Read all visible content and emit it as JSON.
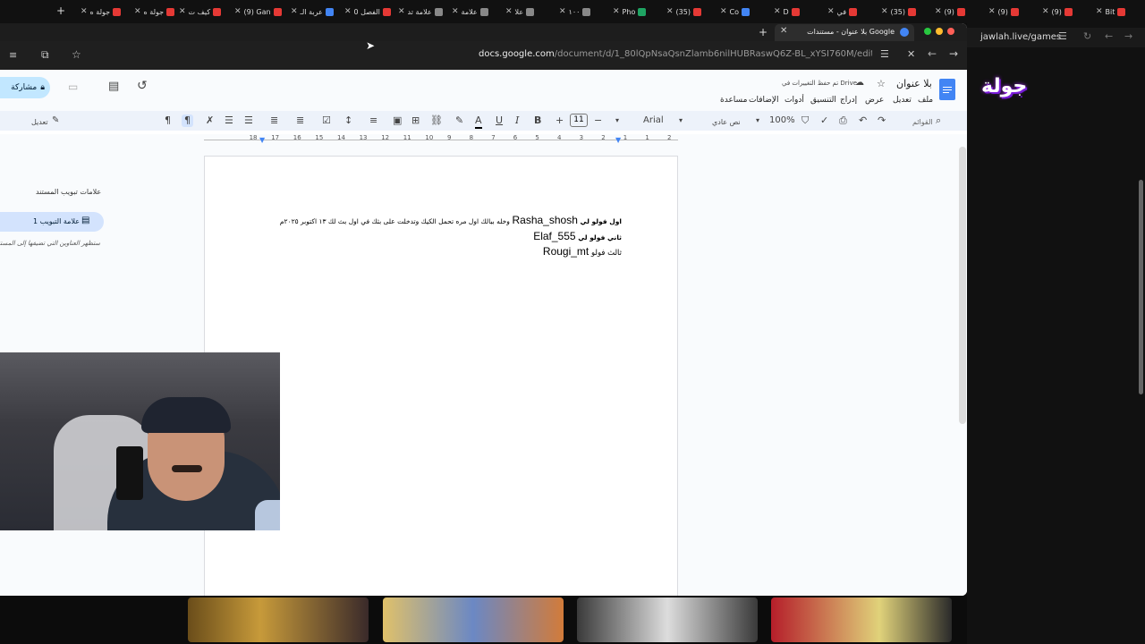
{
  "tabs": [
    {
      "label": "جولة ه",
      "color": "#e53935"
    },
    {
      "label": "جولة ه",
      "color": "#e53935"
    },
    {
      "label": "كيف ت",
      "color": "#e53935"
    },
    {
      "label": "(9) Gan",
      "color": "#e53935"
    },
    {
      "label": "عربة الـ",
      "color": "#4285f4"
    },
    {
      "label": "الفصل 0",
      "color": "#e53935"
    },
    {
      "label": "علامة تد",
      "color": "#888888"
    },
    {
      "label": "علامة",
      "color": "#888888"
    },
    {
      "label": "علا",
      "color": "#888888"
    },
    {
      "label": "١٠٠",
      "color": "#888888"
    },
    {
      "label": "Pho",
      "color": "#1fa463"
    },
    {
      "label": "(35)",
      "color": "#e53935"
    },
    {
      "label": "Co",
      "color": "#4285f4"
    },
    {
      "label": "D",
      "color": "#e53935"
    },
    {
      "label": "في",
      "color": "#e53935"
    },
    {
      "label": "(35)",
      "color": "#e53935"
    },
    {
      "label": "(9)",
      "color": "#e53935"
    },
    {
      "label": "(9)",
      "color": "#e53935"
    },
    {
      "label": "(9)",
      "color": "#e53935"
    },
    {
      "label": "Bit",
      "color": "#e53935"
    }
  ],
  "window": {
    "tab_title": "بلا عنوان - مستندات Google",
    "url_host": "docs.google.com",
    "url_path": "/document/d/1_80lQpNsaQsnZlamb6nilHUBRaswQ6Z-BL_xYSI760M/edit?tab=t.0"
  },
  "right_site": {
    "url": "jawlah.live/games",
    "logo": "جولة"
  },
  "doc": {
    "title": "بلا عنوان",
    "saved_status": "تم حفظ التغييرات في Drive",
    "share_label": "مشاركة",
    "menus": [
      "ملف",
      "تعديل",
      "عرض",
      "إدراج",
      "التنسيق",
      "أدوات",
      "الإضافات",
      "مساعدة"
    ],
    "toolbar": {
      "search_placeholder": "القوائم",
      "zoom": "100%",
      "style": "نص عادي",
      "font": "Arial",
      "font_size": "11",
      "edit_mode": "تعديل"
    },
    "ruler_numbers": [
      "2",
      "1",
      "1",
      "2",
      "3",
      "4",
      "5",
      "6",
      "7",
      "8",
      "9",
      "10",
      "11",
      "12",
      "13",
      "14",
      "15",
      "16",
      "17",
      "18"
    ],
    "lines": [
      {
        "prefix": "اول فولو لي",
        "handle": "Rasha_shosh",
        "suffix": "وخله ببالك اول مره تحمل الكيك وتدخلت على بثك في اول بث لك ١٣ اكتوبر ٢٠٢٥م"
      },
      {
        "prefix": "ثاني فولو لي",
        "handle": "Elaf_555",
        "suffix": ""
      },
      {
        "prefix": "ثالث فولو",
        "handle": "Rougi_mt",
        "suffix": ""
      }
    ],
    "outline": {
      "heading": "علامات تبويب المستند",
      "tab_item": "علامة التبويب 1",
      "hint": "ستظهر العناوين التي تضيفها إلى المستند هنا."
    }
  }
}
